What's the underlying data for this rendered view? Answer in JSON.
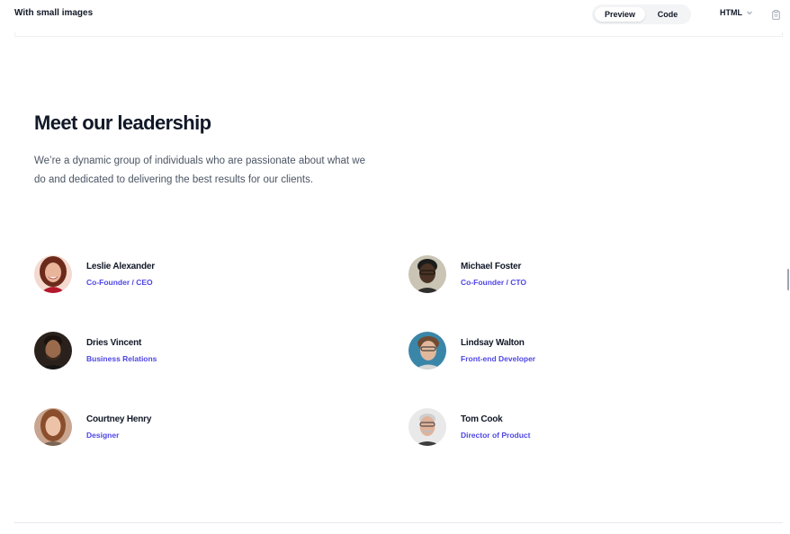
{
  "topbar": {
    "title": "With small images",
    "tabs": [
      {
        "label": "Preview",
        "active": true
      },
      {
        "label": "Code",
        "active": false
      }
    ],
    "language": "HTML",
    "icons": {
      "language_dropdown": "chevron-down-icon",
      "copy": "clipboard-icon"
    }
  },
  "content": {
    "heading": "Meet our leadership",
    "intro": "We’re a dynamic group of individuals who are passionate about what we do and dedicated to delivering the best results for our clients.",
    "people": [
      {
        "name": "Leslie Alexander",
        "role": "Co-Founder / CEO"
      },
      {
        "name": "Michael Foster",
        "role": "Co-Founder / CTO"
      },
      {
        "name": "Dries Vincent",
        "role": "Business Relations"
      },
      {
        "name": "Lindsay Walton",
        "role": "Front-end Developer"
      },
      {
        "name": "Courtney Henry",
        "role": "Designer"
      },
      {
        "name": "Tom Cook",
        "role": "Director of Product"
      }
    ]
  },
  "colors": {
    "accent": "#4f46e5",
    "heading": "#111827",
    "body_text": "#4b5563"
  }
}
